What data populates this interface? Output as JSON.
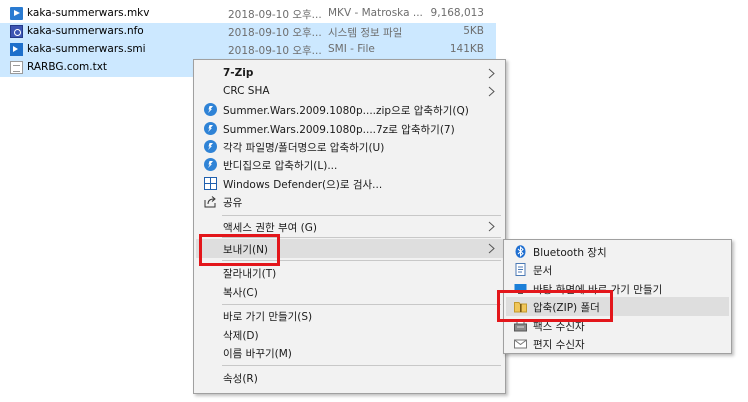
{
  "files": [
    {
      "name": "kaka-summerwars.mkv",
      "date": "2018-09-10 오후...",
      "type": "MKV - Matroska ...",
      "size": "9,168,013",
      "icon": "mkv-file-icon",
      "selected": false
    },
    {
      "name": "kaka-summerwars.nfo",
      "date": "2018-09-10 오후...",
      "type": "시스템 정보 파일",
      "size": "5KB",
      "icon": "nfo-file-icon",
      "selected": true
    },
    {
      "name": "kaka-summerwars.smi",
      "date": "2018-09-10 오후...",
      "type": "SMI - File",
      "size": "141KB",
      "icon": "smi-file-icon",
      "selected": true
    },
    {
      "name": "RARBG.com.txt",
      "date": "",
      "type": "",
      "size": "",
      "icon": "txt-file-icon",
      "selected": true
    }
  ],
  "context_menu": {
    "items": [
      {
        "label": "7-Zip",
        "submenu": true
      },
      {
        "label": "CRC SHA",
        "submenu": true
      },
      {
        "label": "Summer.Wars.2009.1080p....zip으로 압축하기(Q)",
        "icon": "bandizip-icon"
      },
      {
        "label": "Summer.Wars.2009.1080p....7z로 압축하기(7)",
        "icon": "bandizip-icon"
      },
      {
        "label": "각각 파일명/폴더명으로 압축하기(U)",
        "icon": "bandizip-icon"
      },
      {
        "label": "반디집으로 압축하기(L)...",
        "icon": "bandizip-icon"
      },
      {
        "label": "Windows Defender(으)로 검사...",
        "icon": "windows-defender-icon"
      },
      {
        "label": "공유",
        "icon": "share-icon"
      },
      {
        "label": "액세스 권한 부여 (G)",
        "submenu": true
      },
      {
        "label": "보내기(N)",
        "submenu": true
      },
      {
        "label": "잘라내기(T)"
      },
      {
        "label": "복사(C)"
      },
      {
        "label": "바로 가기 만들기(S)"
      },
      {
        "label": "삭제(D)"
      },
      {
        "label": "이름 바꾸기(M)"
      },
      {
        "label": "속성(R)"
      }
    ]
  },
  "send_to_menu": {
    "items": [
      {
        "label": "Bluetooth 장치",
        "icon": "bluetooth-icon"
      },
      {
        "label": "문서",
        "icon": "documents-icon"
      },
      {
        "label": "바탕 화면에 바로 가기 만들기",
        "icon": "desktop-icon"
      },
      {
        "label": "압축(ZIP) 폴더",
        "icon": "zip-folder-icon"
      },
      {
        "label": "팩스 수신자",
        "icon": "fax-icon"
      },
      {
        "label": "편지 수신자",
        "icon": "mail-icon"
      }
    ]
  },
  "colors": {
    "selection": "#cce8ff",
    "menu_bg": "#f2f2f2",
    "menu_highlight": "#dedede",
    "annotation_red": "#e3161b"
  }
}
